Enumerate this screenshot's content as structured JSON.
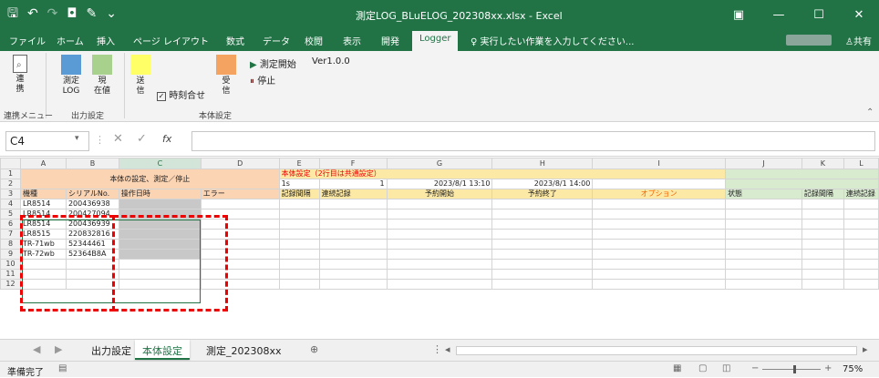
{
  "title": "測定LOG_BLuELOG_202308xx.xlsx - Excel",
  "menu_tabs": [
    "ファイル",
    "ホーム",
    "挿入",
    "ページ レイアウト",
    "数式",
    "データ",
    "校閲",
    "表示",
    "開発",
    "Logger"
  ],
  "active_tab": "Logger",
  "tell_me": "実行したい作業を入力してください...",
  "share": "共有",
  "ribbon": {
    "link": {
      "label": "連\n携"
    },
    "measure_log": {
      "label": "測定\nLOG",
      "color": "#5b9bd5"
    },
    "current": {
      "label": "現\n在値",
      "color": "#a9d18e"
    },
    "send": {
      "label": "送\n信",
      "color": "#ffff66"
    },
    "timesync": {
      "label": "時刻合せ",
      "checked": true
    },
    "receive": {
      "label": "受\n信",
      "color": "#f4a460"
    },
    "start": {
      "label": "測定開始"
    },
    "stop": {
      "label": "停止"
    },
    "version": "Ver1.0.0",
    "groups": {
      "link": "連携メニュー",
      "output": "出力設定",
      "body": "本体設定"
    }
  },
  "name_box": "C4",
  "fx_label": "fx",
  "columns": [
    "A",
    "B",
    "C",
    "D",
    "E",
    "F",
    "G",
    "H",
    "I",
    "J",
    "K",
    "L"
  ],
  "rows": {
    "r1": {
      "A": "本体の設定、測定／停止",
      "E": "本体設定（2行目は共通設定）"
    },
    "r2": {
      "E": "1s",
      "F": "1",
      "G": "2023/8/1 13:10",
      "H": "2023/8/1 14:00"
    },
    "r3": {
      "A": "機種",
      "B": "シリアルNo.",
      "C": "操作日時",
      "D": "エラー",
      "E": "記録間隔",
      "F": "連続記録",
      "G": "予約開始",
      "H": "予約終了",
      "I": "オプション",
      "J": "状態",
      "K": "記録間隔",
      "L": "連続記録"
    },
    "data": [
      {
        "row": "4",
        "A": "LR8514",
        "B": "200436938"
      },
      {
        "row": "5",
        "A": "LR8514",
        "B": "200427094"
      },
      {
        "row": "6",
        "A": "LR8514",
        "B": "200436939"
      },
      {
        "row": "7",
        "A": "LR8515",
        "B": "220832816"
      },
      {
        "row": "8",
        "A": "TR-71wb",
        "B": "52344461"
      },
      {
        "row": "9",
        "A": "TR-72wb",
        "B": "52364B8A"
      }
    ],
    "empty": [
      "10",
      "11",
      "12"
    ]
  },
  "sheet_tabs": [
    "出力設定",
    "本体設定",
    "測定_202308xx"
  ],
  "active_sheet": "本体設定",
  "status": {
    "ready": "準備完了",
    "zoom": "75%"
  }
}
